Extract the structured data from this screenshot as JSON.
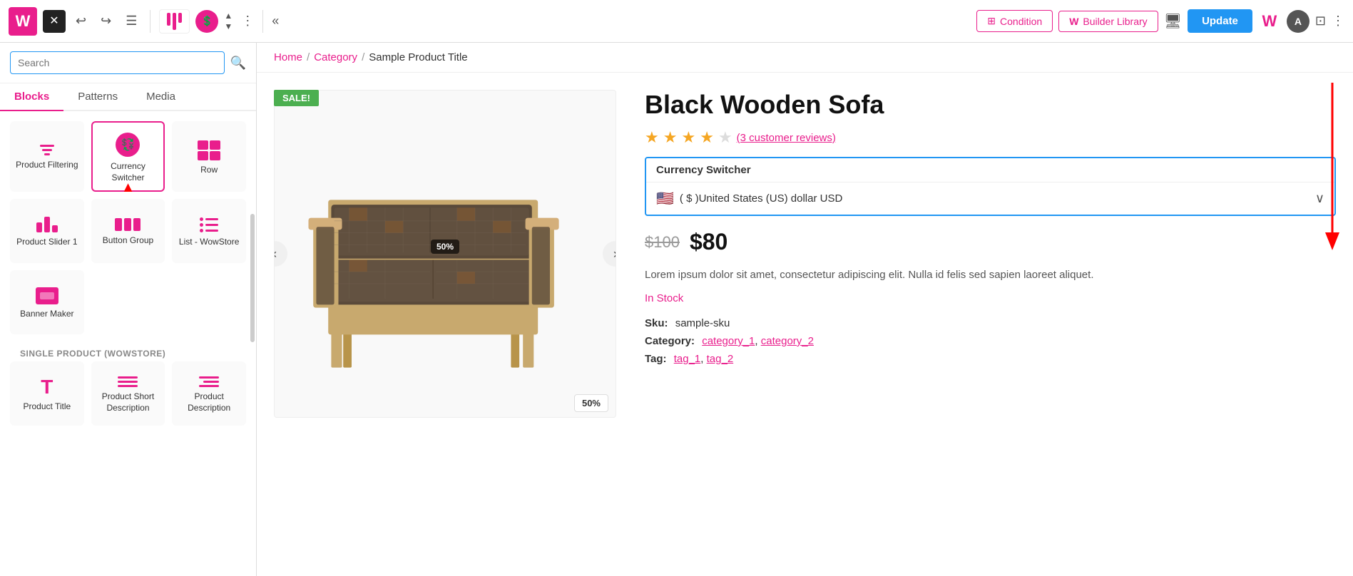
{
  "topbar": {
    "logo_letter": "W",
    "close_label": "✕",
    "undo_icon": "↩",
    "redo_icon": "↪",
    "history_icon": "☰",
    "more_icon": "⋮",
    "chevron_left_icon": "«",
    "condition_label": "Condition",
    "builder_library_label": "Builder Library",
    "update_label": "Update",
    "avatar_letter": "A"
  },
  "left_panel": {
    "search_placeholder": "Search",
    "tabs": [
      "Blocks",
      "Patterns",
      "Media"
    ],
    "active_tab": "Blocks",
    "blocks": [
      {
        "id": "product-filtering",
        "label": "Product Filtering",
        "icon": "filter"
      },
      {
        "id": "currency-switcher",
        "label": "Currency Switcher",
        "icon": "currency",
        "selected": true
      },
      {
        "id": "row",
        "label": "Row",
        "icon": "row"
      },
      {
        "id": "product-slider",
        "label": "Product Slider 1",
        "icon": "slider"
      },
      {
        "id": "button-group",
        "label": "Button Group",
        "icon": "btn-group"
      },
      {
        "id": "list-wowstore",
        "label": "List - WowStore",
        "icon": "list"
      },
      {
        "id": "banner-maker",
        "label": "Banner Maker",
        "icon": "banner"
      }
    ],
    "section_label": "SINGLE PRODUCT (WOWSTORE)",
    "single_product_blocks": [
      {
        "id": "product-title",
        "label": "Product Title",
        "icon": "T"
      },
      {
        "id": "product-short-desc",
        "label": "Product Short Description",
        "icon": "lines"
      },
      {
        "id": "product-description",
        "label": "Product Description",
        "icon": "lines-right"
      }
    ]
  },
  "canvas": {
    "breadcrumb": {
      "home": "Home",
      "category": "Category",
      "current": "Sample Product Title"
    },
    "product": {
      "sale_badge": "SALE!",
      "title": "Black Wooden Sofa",
      "rating": 4,
      "max_rating": 5,
      "reviews_text": "(3 customer reviews)",
      "currency_switcher_label": "Currency Switcher",
      "currency_option": "( $ )United States (US) dollar USD",
      "old_price": "$100",
      "new_price": "$80",
      "description": "Lorem ipsum dolor sit amet, consectetur adipiscing elit. Nulla id felis sed sapien laoreet aliquet.",
      "stock_status": "In Stock",
      "sku_label": "Sku:",
      "sku_value": "sample-sku",
      "category_label": "Category:",
      "categories": [
        "category_1",
        "category_2"
      ],
      "tag_label": "Tag:",
      "tags": [
        "tag_1",
        "tag_2"
      ],
      "discount_badge": "50%"
    }
  }
}
